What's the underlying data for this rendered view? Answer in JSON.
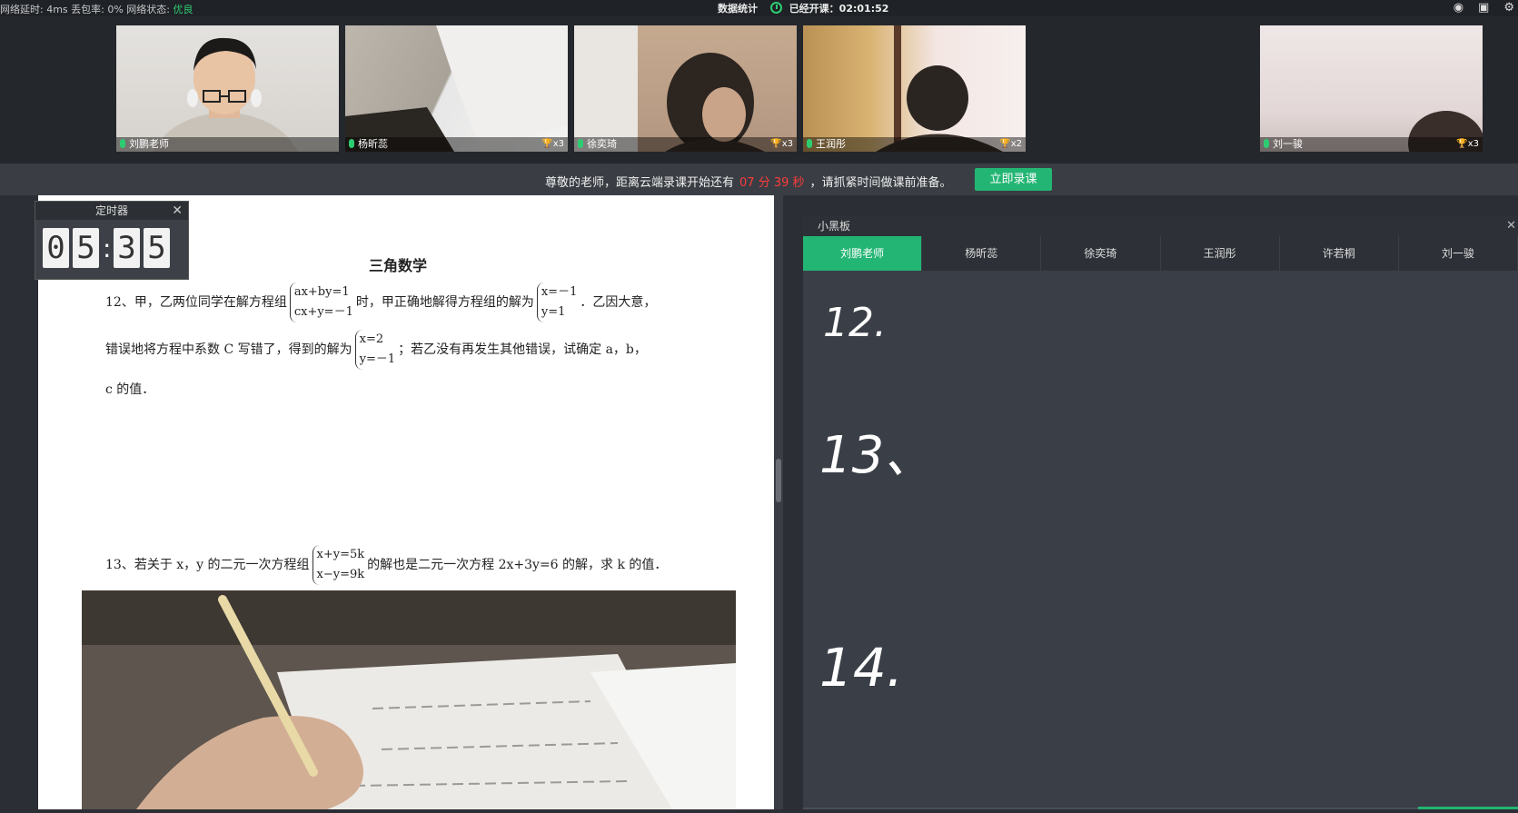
{
  "topbar": {
    "network_text": "网络延时: 4ms  丢包率: 0%  网络状态: ",
    "network_status": "优良",
    "stats_label": "数据统计",
    "class_time_label": "已经开课：02:01:52"
  },
  "video_tiles": [
    {
      "name": "刘鹏老师",
      "trophy": ""
    },
    {
      "name": "杨昕蕊",
      "trophy": "x3"
    },
    {
      "name": "徐奕琦",
      "trophy": "x3"
    },
    {
      "name": "王润彤",
      "trophy": "x2"
    },
    {
      "name": "刘一骏",
      "trophy": "x3"
    }
  ],
  "notice": {
    "prefix": "尊敬的老师，距离云端录课开始还有",
    "countdown": "07 分 39 秒",
    "suffix": "，请抓紧时间做课前准备。",
    "record_button": "立即录课"
  },
  "timer": {
    "title": "定时器",
    "close": "✕",
    "d1": "0",
    "d2": "5",
    "d3": "3",
    "d4": "5"
  },
  "document": {
    "title": "三角数学",
    "q12_a": "12、甲，乙两位同学在解方程组",
    "q12_sys_1": "ax+by=1",
    "q12_sys_2": "cx+y=－1",
    "q12_b": "时，甲正确地解得方程组的解为",
    "q12_sol_1": "x=－1",
    "q12_sol_2": "y=1",
    "q12_c": "．乙因大意，",
    "q12_d": "错误地将方程中系数 C 写错了，得到的解为",
    "q12_sol2_1": "x=2",
    "q12_sol2_2": "y=－1",
    "q12_e": "；若乙没有再发生其他错误，试确定 a，b，",
    "q12_f": "c 的值．",
    "q13_a": "13、若关于 x，y 的二元一次方程组",
    "q13_sys_1": "x+y=5k",
    "q13_sys_2": "x−y=9k",
    "q13_b": "的解也是二元一次方程 2x+3y=6 的解，求 k 的值．"
  },
  "board": {
    "title": "小黑板",
    "close": "✕",
    "tabs": [
      "刘鹏老师",
      "杨昕蕊",
      "徐奕琦",
      "王润彤",
      "许若桐",
      "刘一骏"
    ],
    "handwriting": [
      "12.",
      "13、",
      "14."
    ]
  }
}
